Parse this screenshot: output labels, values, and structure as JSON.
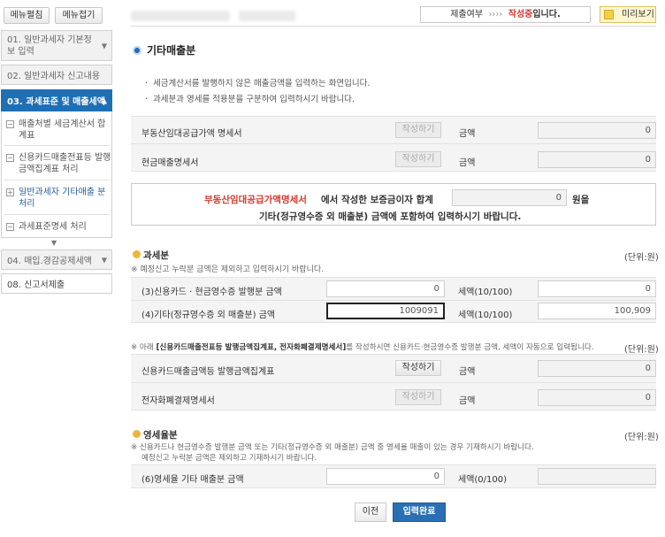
{
  "sidebar": {
    "top_buttons": [
      "메뉴펼침",
      "메뉴접기"
    ],
    "items": [
      {
        "label": "01. 일반과세자 기본정보 입력"
      },
      {
        "label": "02. 일반과세자 신고내용"
      },
      {
        "label": "03. 과세표준 및 매출세액"
      },
      {
        "label": "04. 매입.경감공제세액"
      },
      {
        "label": "08. 신고서제출"
      }
    ],
    "subitems": [
      {
        "mark": "−",
        "label": "매출처별 세금계산서 합계표"
      },
      {
        "mark": "−",
        "label": "신용카드매출전표등 발행금액집계표 처리"
      },
      {
        "mark": "+",
        "label": "일반과세자 기타매출 분 처리"
      },
      {
        "mark": "−",
        "label": "과세표준명세 처리"
      }
    ]
  },
  "header": {
    "status_label": "제출여부",
    "status_arrows": "››››",
    "status_value": "작성중",
    "status_suffix": "입니다.",
    "preview_label": "미리보기"
  },
  "page_title": "기타매출분",
  "bullets": [
    "세금계산서를 발행하지 않은 매출금액을 입력하는 화면입니다.",
    "과세분과 영세를 적용분을 구분하여 입력하시기 바랍니다."
  ],
  "rows_top": [
    {
      "label": "부동산임대공급가액 명세서",
      "button": "작성하기",
      "amount_label": "금액",
      "amount": "0"
    },
    {
      "label": "현금매출명세서",
      "button": "작성하기",
      "amount_label": "금액",
      "amount": "0"
    }
  ],
  "notice": {
    "red": "부동산임대공급가액명세서",
    "part1": "에서 작성한 보증금이자 합계",
    "value": "0",
    "part2": "원을",
    "line2": "기타(정규영수증 외 매출분) 금액에 포함하여 입력하시기 바랍니다."
  },
  "taxable": {
    "title": "과세분",
    "unit": "(단위:원)",
    "note": "※ 예정신고 누락분 금액은 제외하고 입력하시기 바랍니다.",
    "rows": [
      {
        "label": "(3)신용카드 · 현금영수증 발행분 금액",
        "value": "0",
        "tax_label": "세액(10/100)",
        "tax": "0"
      },
      {
        "label": "(4)기타(정규영수증 외 매출분) 금액",
        "value": "1009091",
        "tax_label": "세액(10/100)",
        "tax": "100,909"
      }
    ]
  },
  "card_section": {
    "note_prefix": "※ 아래 ",
    "note_bold": "[신용카드매출전표등 발행금액집계표, 전자화폐결제명세서]",
    "note_suffix": "를 작성하시면 신용카드·현금영수증 발행분 금액, 세액이 자동으로 입력됩니다.",
    "unit": "(단위:원)",
    "rows": [
      {
        "label": "신용카드매출금액등 발행금액집계표",
        "button": "작성하기",
        "amount_label": "금액",
        "amount": "0"
      },
      {
        "label": "전자화폐결제명세서",
        "button": "작성하기",
        "amount_label": "금액",
        "amount": "0"
      }
    ]
  },
  "zero_rated": {
    "title": "영세율분",
    "unit": "(단위:원)",
    "note1": "※ 신용카드나 현금영수증 발행분 금액 또는 기타(정규영수증 외 매출분) 금액 중 영세율 매출이 있는 경우 기재하시기 바랍니다.",
    "note2": "예정신고 누락분 금액은 제외하고 기재하시기 바랍니다.",
    "row": {
      "label": "(6)영세율 기타 매출분 금액",
      "value": "0",
      "tax_label": "세액(0/100)",
      "tax": ""
    }
  },
  "footer": {
    "prev": "이전",
    "done": "입력완료"
  },
  "colors": {
    "primary": "#1f6fb5",
    "accent_red": "#d23a2e",
    "section_dot": "#f0b43a"
  }
}
